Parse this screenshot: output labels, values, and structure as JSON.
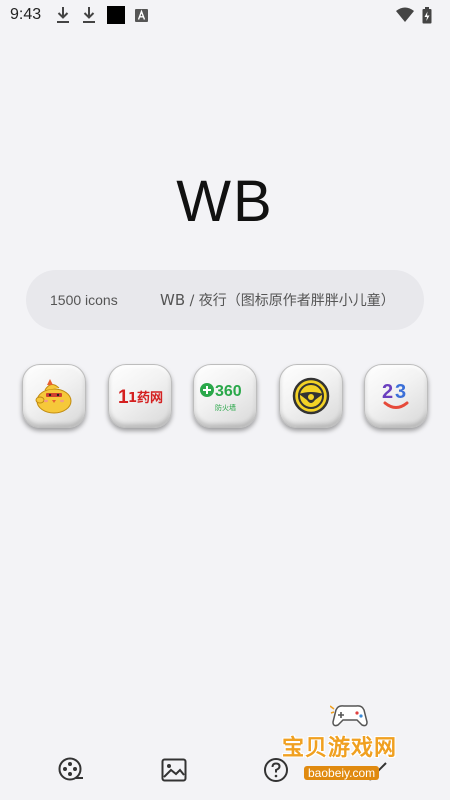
{
  "status_bar": {
    "time": "9:43",
    "left_icons": [
      "download-icon",
      "download-icon",
      "black-square-icon",
      "a-badge-icon"
    ],
    "right_icons": [
      "wifi-icon",
      "battery-icon"
    ]
  },
  "header": {
    "title": "WB"
  },
  "info": {
    "icon_count": "1500 icons",
    "pack_name": "WB",
    "author_line": " / 夜行（图标原作者胖胖小儿童）"
  },
  "icons": [
    {
      "name": "chick-app-icon"
    },
    {
      "name": "1yaowang-app-icon",
      "text": "1药网"
    },
    {
      "name": "360-firewall-app-icon",
      "text": "360",
      "subtext": "防火墙"
    },
    {
      "name": "steering-wheel-app-icon"
    },
    {
      "name": "23-app-icon",
      "text": "23"
    }
  ],
  "bottom_nav": [
    "film-reel-icon",
    "image-icon",
    "help-icon",
    "brush-icon"
  ],
  "watermark": {
    "title": "宝贝游戏网",
    "url": "baobeiy.com"
  },
  "colors": {
    "background": "#f3f3f6",
    "pill": "#e8e8ec",
    "watermark_orange": "#f0a020"
  }
}
